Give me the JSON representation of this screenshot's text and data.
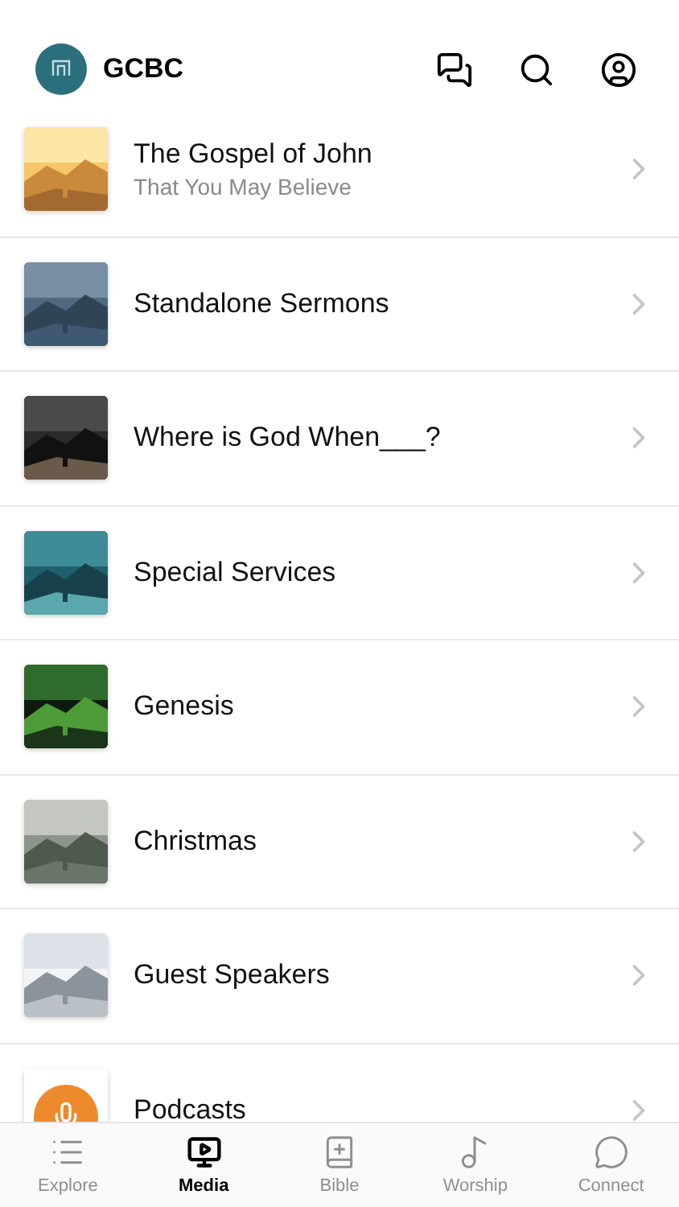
{
  "header": {
    "title": "GCBC"
  },
  "series": [
    {
      "kind": "picture",
      "title": "The Gospel of John",
      "subtitle": "That You May Believe"
    },
    {
      "kind": "picture",
      "title": "Standalone Sermons"
    },
    {
      "kind": "picture",
      "title": "Where is God When___?"
    },
    {
      "kind": "picture",
      "title": "Special Services"
    },
    {
      "kind": "picture",
      "title": "Genesis"
    },
    {
      "kind": "picture",
      "title": "Christmas"
    },
    {
      "kind": "picture",
      "title": "Guest Speakers"
    },
    {
      "kind": "podcast",
      "title": "Podcasts"
    }
  ],
  "tabs": [
    {
      "label": "Explore",
      "kind": "list",
      "selected": false
    },
    {
      "label": "Media",
      "kind": "media",
      "selected": true
    },
    {
      "label": "Bible",
      "kind": "bible",
      "selected": false
    },
    {
      "label": "Worship",
      "kind": "music",
      "selected": false
    },
    {
      "label": "Connect",
      "kind": "chat",
      "selected": false
    }
  ]
}
